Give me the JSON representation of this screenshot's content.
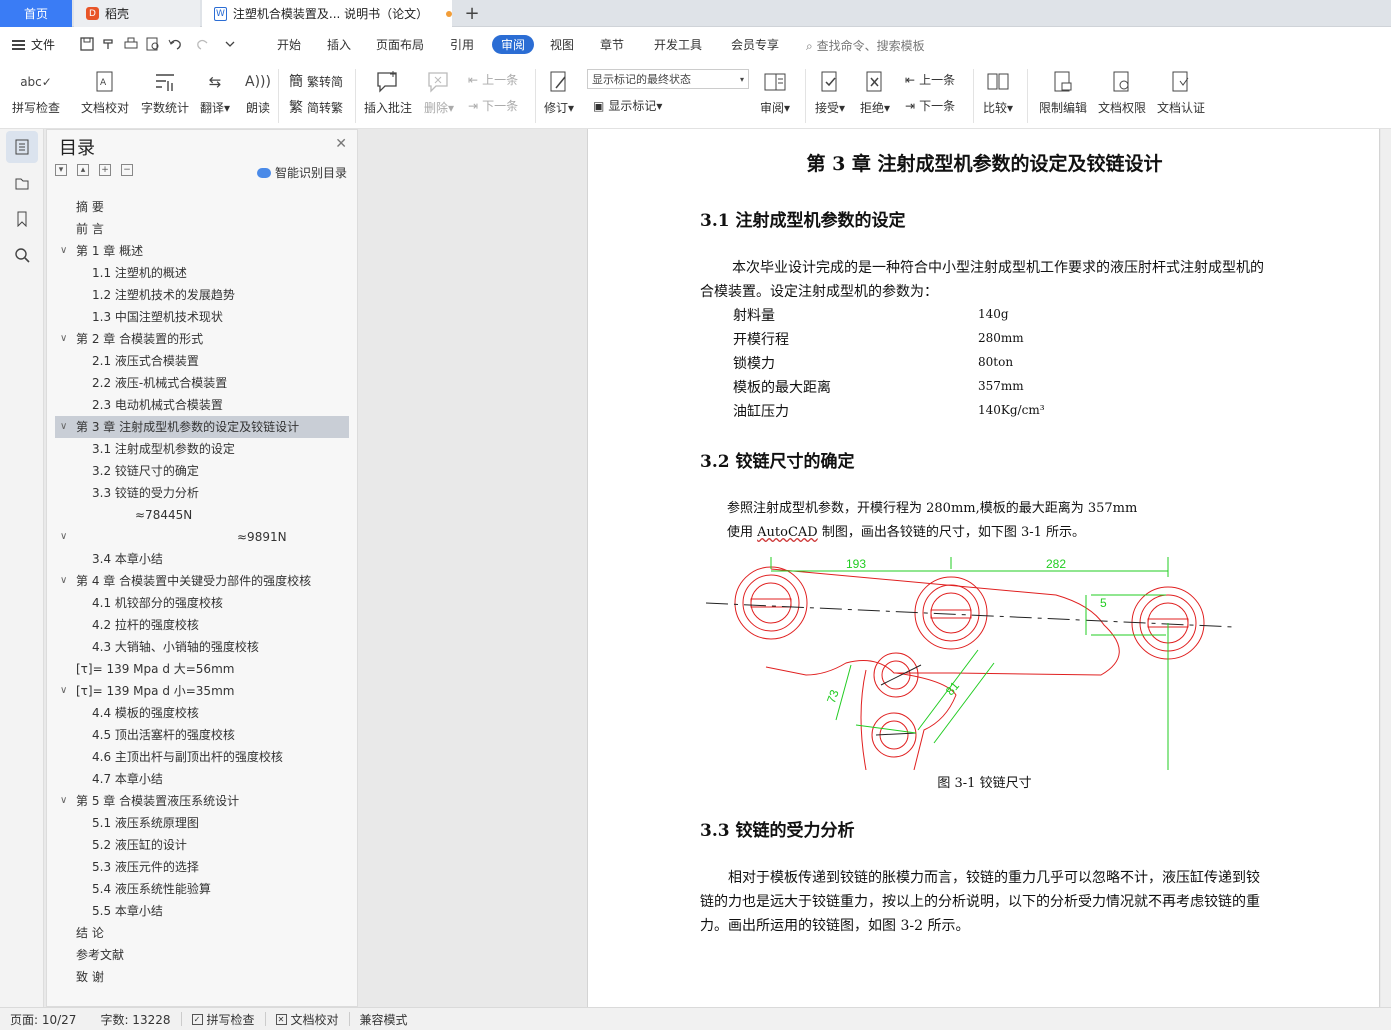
{
  "tabs": {
    "home": "首页",
    "daoke": "稻壳",
    "doc": "注塑机合模装置及... 说明书（论文）",
    "plus": "+"
  },
  "menubar": {
    "file": "文件",
    "tabs": [
      "开始",
      "插入",
      "页面布局",
      "引用",
      "审阅",
      "视图",
      "章节",
      "开发工具",
      "会员专享"
    ],
    "active_tab": "审阅",
    "search": "查找命令、搜索模板"
  },
  "ribbon": {
    "spell": "拼写检查",
    "doccheck": "文档校对",
    "wordcount": "字数统计",
    "translate": "翻译",
    "read": "朗读",
    "trad": "繁转简",
    "simp": "简转繁",
    "insert_comment": "插入批注",
    "delete": "删除",
    "prev_comment": "上一条",
    "next_comment": "下一条",
    "revise": "修订",
    "display_select": "显示标记的最终状态",
    "show_marks": "显示标记",
    "review": "审阅",
    "accept": "接受",
    "reject": "拒绝",
    "prev_change": "上一条",
    "next_change": "下一条",
    "compare": "比较",
    "restrict": "限制编辑",
    "doc_perm": "文档权限",
    "doc_auth": "文档认证"
  },
  "toc": {
    "title": "目录",
    "smart": "智能识别目录",
    "items": [
      {
        "text": "摘  要",
        "level": 1,
        "chev": false,
        "sel": false
      },
      {
        "text": "前  言",
        "level": 1,
        "chev": false,
        "sel": false
      },
      {
        "text": "第 1 章    概述",
        "level": 1,
        "chev": true,
        "sel": false
      },
      {
        "text": "1.1  注塑机的概述",
        "level": 2,
        "chev": false,
        "sel": false
      },
      {
        "text": "1.2    注塑机技术的发展趋势",
        "level": 2,
        "chev": false,
        "sel": false
      },
      {
        "text": "1.3    中国注塑机技术现状",
        "level": 2,
        "chev": false,
        "sel": false
      },
      {
        "text": "第 2 章    合模装置的形式",
        "level": 1,
        "chev": true,
        "sel": false
      },
      {
        "text": "2.1    液压式合模装置",
        "level": 2,
        "chev": false,
        "sel": false
      },
      {
        "text": "2.2    液压-机械式合模装置",
        "level": 2,
        "chev": false,
        "sel": false
      },
      {
        "text": "2.3    电动机械式合模装置",
        "level": 2,
        "chev": false,
        "sel": false
      },
      {
        "text": "第 3 章    注射成型机参数的设定及铰链设计",
        "level": 1,
        "chev": true,
        "sel": true
      },
      {
        "text": "3.1    注射成型机参数的设定",
        "level": 2,
        "chev": false,
        "sel": false
      },
      {
        "text": "3.2    铰链尺寸的确定",
        "level": 2,
        "chev": false,
        "sel": false
      },
      {
        "text": "3.3    铰链的受力分析",
        "level": 2,
        "chev": false,
        "sel": false
      },
      {
        "text": "≈78445N",
        "level": 3,
        "chev": false,
        "sel": false
      },
      {
        "text": "≈9891N",
        "level": 4,
        "chev": true,
        "sel": false
      },
      {
        "text": "3.4    本章小结",
        "level": 2,
        "chev": false,
        "sel": false
      },
      {
        "text": "第 4 章    合模装置中关键受力部件的强度校核",
        "level": 1,
        "chev": true,
        "sel": false
      },
      {
        "text": "4.1    机铰部分的强度校核",
        "level": 2,
        "chev": false,
        "sel": false
      },
      {
        "text": "4.2    拉杆的强度校核",
        "level": 2,
        "chev": false,
        "sel": false
      },
      {
        "text": "4.3    大销轴、小销轴的强度校核",
        "level": 2,
        "chev": false,
        "sel": false
      },
      {
        "text": "[τ]= 139 Mpa        d 大=56mm",
        "level": 1,
        "chev": false,
        "sel": false
      },
      {
        "text": "[τ]= 139 Mpa        d 小=35mm",
        "level": 1,
        "chev": true,
        "sel": false
      },
      {
        "text": "4.4    模板的强度校核",
        "level": 2,
        "chev": false,
        "sel": false
      },
      {
        "text": "4.5    顶出活塞杆的强度校核",
        "level": 2,
        "chev": false,
        "sel": false
      },
      {
        "text": "4.6    主顶出杆与副顶出杆的强度校核",
        "level": 2,
        "chev": false,
        "sel": false
      },
      {
        "text": "4.7    本章小结",
        "level": 2,
        "chev": false,
        "sel": false
      },
      {
        "text": "第 5 章    合模装置液压系统设计",
        "level": 1,
        "chev": true,
        "sel": false
      },
      {
        "text": "5.1    液压系统原理图",
        "level": 2,
        "chev": false,
        "sel": false
      },
      {
        "text": "5.2    液压缸的设计",
        "level": 2,
        "chev": false,
        "sel": false
      },
      {
        "text": "5.3    液压元件的选择",
        "level": 2,
        "chev": false,
        "sel": false
      },
      {
        "text": "5.4    液压系统性能验算",
        "level": 2,
        "chev": false,
        "sel": false
      },
      {
        "text": "5.5    本章小结",
        "level": 2,
        "chev": false,
        "sel": false
      },
      {
        "text": "结    论",
        "level": 1,
        "chev": false,
        "sel": false
      },
      {
        "text": "参考文献",
        "level": 1,
        "chev": false,
        "sel": false
      },
      {
        "text": "致    谢",
        "level": 1,
        "chev": false,
        "sel": false
      }
    ]
  },
  "doc": {
    "chapter": "第 3 章    注射成型机参数的设定及铰链设计",
    "s31": "3.1    注射成型机参数的设定",
    "p1": "本次毕业设计完成的是一种符合中小型注射成型机工作要求的液压肘杆式注射成型机的合模装置。设定注射成型机的参数为：",
    "params": [
      {
        "name": "射料量",
        "value": "140g"
      },
      {
        "name": "开模行程",
        "value": "280mm"
      },
      {
        "name": "锁模力",
        "value": "80ton"
      },
      {
        "name": "模板的最大距离",
        "value": "357mm"
      },
      {
        "name": "油缸压力",
        "value": "140Kg/cm³"
      }
    ],
    "s32": "3.2    铰链尺寸的确定",
    "p2a": "参照注射成型机参数，开模行程为 280mm,模板的最大距离为 357mm",
    "p2b_pre": "使用 ",
    "p2b_link": "AutoCAD",
    "p2b_post": " 制图，画出各铰链的尺寸，如下图 3-1 所示。",
    "dims": {
      "d1": "193",
      "d2": "282",
      "d3": "5",
      "d4": "73",
      "d5": "81"
    },
    "fig_caption": "图 3-1 铰链尺寸",
    "s33": "3.3    铰链的受力分析",
    "p3": "相对于模板传递到铰链的胀模力而言，铰链的重力几乎可以忽略不计，液压缸传递到铰链的力也是远大于铰链重力，按以上的分析说明，以下的分析受力情况就不再考虑铰链的重力。画出所运用的铰链图，如图 3-2 所示。"
  },
  "status": {
    "page": "页面: 10/27",
    "words": "字数: 13228",
    "spell": "拼写检查",
    "doccheck": "文档校对",
    "compat": "兼容模式"
  }
}
